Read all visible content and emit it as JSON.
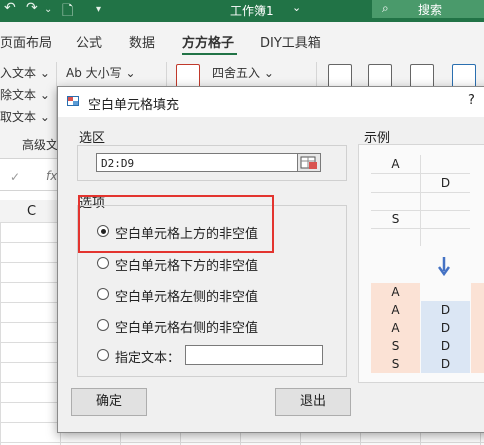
{
  "excel": {
    "window_title": "工作簿1",
    "title_dropdown": "⌄",
    "search_label": "搜索",
    "search_icon": "search-icon",
    "ribbon_tabs": [
      "页面布局",
      "公式",
      "数据",
      "方方格子",
      "DIY工具箱"
    ],
    "active_tab": "方方格子",
    "ribbon_items": {
      "insert_text": "入文本 ⌄",
      "delete_text": "除文本 ⌄",
      "extract_text": "取文本 ⌄",
      "advanced_text": "高级文",
      "ab_size": "Ab 大小写 ⌄",
      "round_half_up": "四舍五入 ⌄"
    },
    "formula_fx": "fx",
    "formula_check": "✓",
    "column_header_c": "C"
  },
  "dialog": {
    "title": "空白单元格填充",
    "help": "?",
    "range_group_label": "选区",
    "range_value": "D2:D9",
    "options_group_label": "选项",
    "options": [
      {
        "label": "空白单元格上方的非空值",
        "checked": true
      },
      {
        "label": "空白单元格下方的非空值",
        "checked": false
      },
      {
        "label": "空白单元格左侧的非空值",
        "checked": false
      },
      {
        "label": "空白单元格右侧的非空值",
        "checked": false
      },
      {
        "label": "指定文本：",
        "checked": false
      }
    ],
    "specified_text_value": "",
    "ok_button": "确定",
    "exit_button": "退出",
    "example_label": "示例",
    "example_before": [
      "A",
      "D",
      "S"
    ],
    "example_after": [
      [
        "A",
        ""
      ],
      [
        "A",
        "D"
      ],
      [
        "A",
        "D"
      ],
      [
        "S",
        "D"
      ],
      [
        "S",
        "D"
      ]
    ],
    "arrow_icon": "down-arrow-icon",
    "colors": {
      "excel_green": "#217346",
      "highlight_red": "#e3342f",
      "example_orange": "#fbe2d5",
      "example_blue": "#dbe6f4",
      "arrow_blue": "#4472c4"
    }
  }
}
